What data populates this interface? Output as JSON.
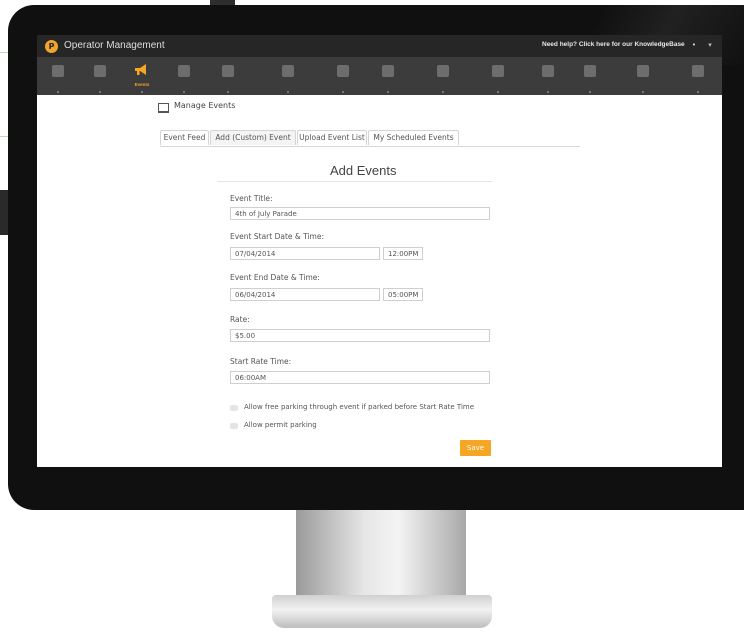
{
  "app": {
    "title": "Operator Management",
    "logo_glyph": "P",
    "help_text": "Need help? Click here for our KnowledgeBase",
    "user_glyph": "•",
    "caret_glyph": "▾",
    "accent_color": "#f5a623"
  },
  "nav": {
    "items": [
      {
        "icon": "dashboard-icon",
        "label": ""
      },
      {
        "icon": "reports-icon",
        "label": ""
      },
      {
        "icon": "megaphone-icon",
        "label": "Events"
      },
      {
        "icon": "rates-icon",
        "label": ""
      },
      {
        "icon": "cards-icon",
        "label": ""
      },
      {
        "icon": "edit-icon",
        "label": ""
      },
      {
        "icon": "facility-icon",
        "label": ""
      },
      {
        "icon": "receipt-icon",
        "label": ""
      },
      {
        "icon": "users-icon",
        "label": ""
      },
      {
        "icon": "tags-icon",
        "label": ""
      },
      {
        "icon": "chat-icon",
        "label": ""
      },
      {
        "icon": "list-icon",
        "label": ""
      },
      {
        "icon": "settings-icon",
        "label": ""
      },
      {
        "icon": "network-icon",
        "label": ""
      }
    ]
  },
  "panel": {
    "title": "Manage Events"
  },
  "tabs": [
    {
      "label": "Event Feed",
      "active": false
    },
    {
      "label": "Add (Custom) Event",
      "active": true
    },
    {
      "label": "Upload Event List",
      "active": false
    },
    {
      "label": "My Scheduled Events",
      "active": false
    }
  ],
  "form": {
    "title": "Add Events",
    "event_title_label": "Event Title:",
    "event_title_value": "4th of July Parade",
    "start_label": "Event Start Date & Time:",
    "start_date": "07/04/2014",
    "start_time": "12:00PM",
    "end_label": "Event End Date & Time:",
    "end_date": "06/04/2014",
    "end_time": "05:00PM",
    "rate_label": "Rate:",
    "rate_value": "$5.00",
    "start_rate_label": "Start Rate Time:",
    "start_rate_value": "06:00AM",
    "free_parking_label": "Allow free parking through event if parked before Start Rate Time",
    "permit_parking_label": "Allow permit parking",
    "save_label": "Save"
  }
}
